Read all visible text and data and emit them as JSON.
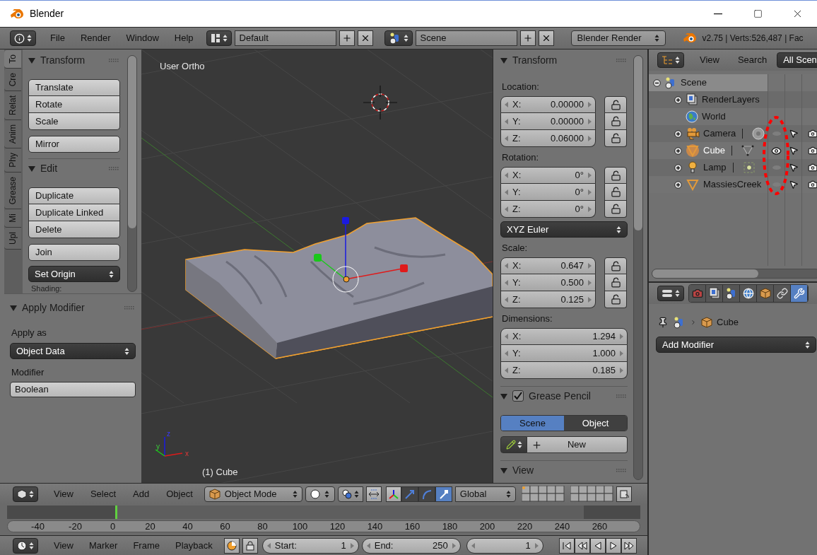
{
  "window": {
    "title": "Blender"
  },
  "info_header": {
    "menus": [
      "File",
      "Render",
      "Window",
      "Help"
    ],
    "layout": "Default",
    "scene": "Scene",
    "engine": "Blender Render",
    "stats": "v2.75 | Verts:526,487 | Fac"
  },
  "tool_shelf": {
    "tabs": [
      {
        "label": "To",
        "selected": true
      },
      {
        "label": "Cre",
        "selected": false
      },
      {
        "label": "Relat",
        "selected": false
      },
      {
        "label": "Anim",
        "selected": false
      },
      {
        "label": "Phy",
        "selected": false
      },
      {
        "label": "Grease",
        "selected": false
      },
      {
        "label": "Mi",
        "selected": false
      },
      {
        "label": "Upl",
        "selected": false
      }
    ],
    "panels": [
      {
        "title": "Transform",
        "groups": [
          [
            "Translate",
            "Rotate",
            "Scale"
          ],
          [
            "Mirror"
          ]
        ]
      },
      {
        "title": "Edit",
        "groups": [
          [
            "Duplicate",
            "Duplicate Linked",
            "Delete"
          ],
          [
            "Join"
          ]
        ],
        "dropdown": "Set Origin"
      }
    ],
    "next_label": "Shading:"
  },
  "operator_panel": {
    "title": "Apply Modifier",
    "fields": [
      {
        "label": "Apply as",
        "value": "Object Data",
        "kind": "dropdown"
      },
      {
        "label": "Modifier",
        "value": "Boolean",
        "kind": "text"
      }
    ]
  },
  "viewport": {
    "view_name": "User Ortho",
    "object_label": "(1) Cube",
    "axes": [
      "z",
      "y",
      "x"
    ]
  },
  "sidebar": {
    "transform": {
      "title": "Transform",
      "groups": [
        {
          "label": "Location:",
          "kind": "lockable",
          "fields": [
            {
              "axis": "X:",
              "value": "0.00000"
            },
            {
              "axis": "Y:",
              "value": "0.00000"
            },
            {
              "axis": "Z:",
              "value": "0.06000"
            }
          ]
        },
        {
          "label": "Rotation:",
          "kind": "lockable",
          "fields": [
            {
              "axis": "X:",
              "value": "0°"
            },
            {
              "axis": "Y:",
              "value": "0°"
            },
            {
              "axis": "Z:",
              "value": "0°"
            }
          ],
          "mode": "XYZ Euler"
        },
        {
          "label": "Scale:",
          "kind": "lockable",
          "fields": [
            {
              "axis": "X:",
              "value": "0.647"
            },
            {
              "axis": "Y:",
              "value": "0.500"
            },
            {
              "axis": "Z:",
              "value": "0.125"
            }
          ]
        },
        {
          "label": "Dimensions:",
          "kind": "plain",
          "fields": [
            {
              "axis": "X:",
              "value": "1.294"
            },
            {
              "axis": "Y:",
              "value": "1.000"
            },
            {
              "axis": "Z:",
              "value": "0.185"
            }
          ]
        }
      ]
    },
    "grease_pencil": {
      "title": "Grease Pencil",
      "checked": true,
      "tabs": [
        {
          "label": "Scene",
          "selected": true
        },
        {
          "label": "Object",
          "selected": false
        }
      ],
      "button": "New"
    },
    "view": {
      "title": "View"
    }
  },
  "outliner": {
    "menus": [
      "View",
      "Search"
    ],
    "scope": "All Scen",
    "tree": [
      {
        "name": "Scene",
        "kind": "scene",
        "selected": true,
        "expanded": true,
        "children": [
          {
            "name": "RenderLayers",
            "kind": "renderlayers",
            "expanded": false
          },
          {
            "name": "World",
            "kind": "world"
          },
          {
            "name": "Camera",
            "kind": "camera",
            "expanded": false,
            "active": false,
            "linked_data": true,
            "visible": false
          },
          {
            "name": "Cube",
            "kind": "mesh",
            "expanded": false,
            "active": true,
            "linked_data": true,
            "visible": true
          },
          {
            "name": "Lamp",
            "kind": "lamp",
            "expanded": false,
            "active": false,
            "linked_data": true,
            "visible": false
          },
          {
            "name": "MassiesCreek",
            "kind": "mesh",
            "expanded": false,
            "active": false,
            "linked_data": false,
            "visible": false
          }
        ]
      }
    ]
  },
  "properties": {
    "tabs": [
      {
        "kind": "render",
        "selected": false
      },
      {
        "kind": "render_layers",
        "selected": false
      },
      {
        "kind": "scene",
        "selected": false
      },
      {
        "kind": "world",
        "selected": false
      },
      {
        "kind": "object",
        "selected": false
      },
      {
        "kind": "constraints",
        "selected": false
      },
      {
        "kind": "modifiers",
        "selected": true
      }
    ],
    "breadcrumb": "Cube",
    "add_modifier": "Add Modifier"
  },
  "view3d_header": {
    "menus": [
      "View",
      "Select",
      "Add",
      "Object"
    ],
    "mode": "Object Mode",
    "manipulators": [
      {
        "kind": "translate",
        "selected": false
      },
      {
        "kind": "rotate",
        "selected": false
      },
      {
        "kind": "scale",
        "selected": true
      }
    ],
    "orientation": "Global"
  },
  "timeline": {
    "ticks": [
      "-40",
      "-20",
      "0",
      "20",
      "40",
      "60",
      "80",
      "100",
      "120",
      "140",
      "160",
      "180",
      "200",
      "220",
      "240",
      "260"
    ],
    "header": {
      "menus": [
        "View",
        "Marker",
        "Frame",
        "Playback"
      ],
      "start": {
        "label": "Start:",
        "value": "1"
      },
      "end": {
        "label": "End:",
        "value": "250"
      },
      "current": "1"
    }
  }
}
